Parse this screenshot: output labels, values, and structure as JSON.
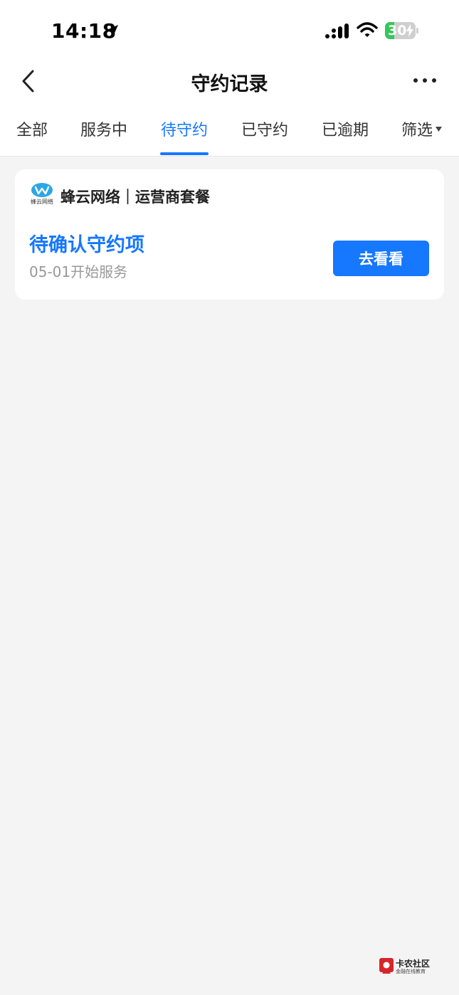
{
  "status_bar": {
    "time": "14:18",
    "battery": "30",
    "battery_level": 0.3
  },
  "nav": {
    "title": "守约记录"
  },
  "tabs": [
    {
      "label": "全部",
      "active": false
    },
    {
      "label": "服务中",
      "active": false
    },
    {
      "label": "待守约",
      "active": true
    },
    {
      "label": "已守约",
      "active": false
    },
    {
      "label": "已逾期",
      "active": false
    },
    {
      "label": "筛选",
      "active": false
    }
  ],
  "card": {
    "merchant": "蜂云网络｜运营商套餐",
    "logo_text": "蜂云网络",
    "title": "待确认守约项",
    "subtitle": "05-01开始服务",
    "button": "去看看"
  },
  "watermark": {
    "title": "卡农社区",
    "subtitle": "金融在线教育"
  },
  "colors": {
    "accent": "#1677ff",
    "background": "#f4f4f4",
    "card": "#ffffff",
    "battery_green": "#34c759"
  }
}
